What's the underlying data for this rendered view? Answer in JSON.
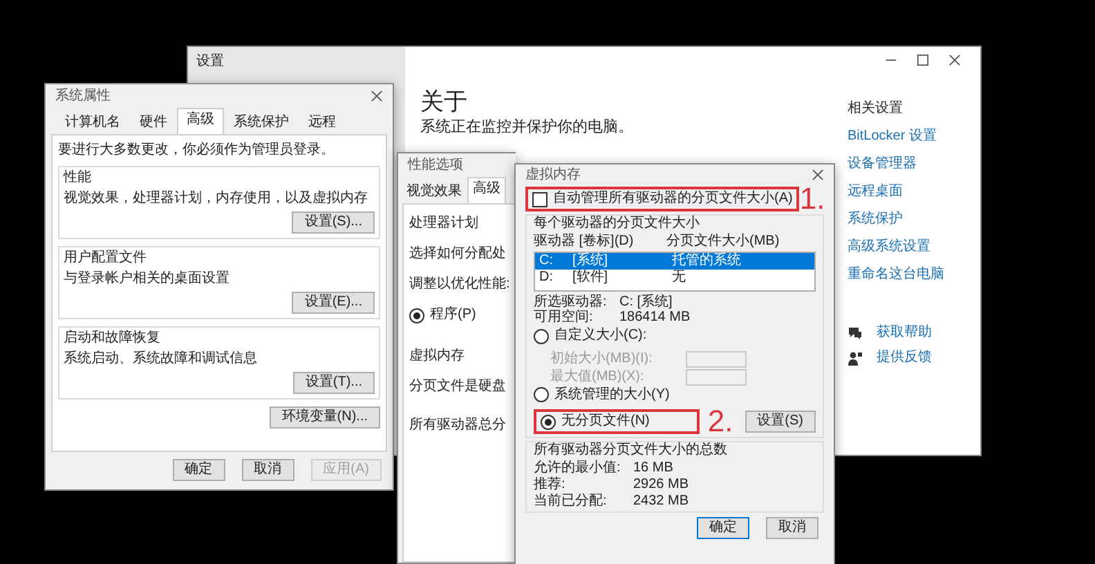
{
  "settings": {
    "title": "设置",
    "heading": "关于",
    "status": "系统正在监控并保护你的电脑。",
    "related_title": "相关设置",
    "related_links": [
      "BitLocker 设置",
      "设备管理器",
      "远程桌面",
      "系统保护",
      "高级系统设置",
      "重命名这台电脑"
    ],
    "support_links": [
      {
        "kind": "help",
        "label": "获取帮助"
      },
      {
        "kind": "feedback",
        "label": "提供反馈"
      }
    ]
  },
  "system_properties": {
    "title": "系统属性",
    "tabs": [
      {
        "label": "计算机名",
        "selected": false
      },
      {
        "label": "硬件",
        "selected": false
      },
      {
        "label": "高级",
        "selected": true
      },
      {
        "label": "系统保护",
        "selected": false
      },
      {
        "label": "远程",
        "selected": false
      }
    ],
    "note": "要进行大多数更改，你必须作为管理员登录。",
    "groups": [
      {
        "title": "性能",
        "description": "视觉效果，处理器计划，内存使用，以及虚拟内存",
        "button": "设置(S)..."
      },
      {
        "title": "用户配置文件",
        "description": "与登录帐户相关的桌面设置",
        "button": "设置(E)..."
      },
      {
        "title": "启动和故障恢复",
        "description": "系统启动、系统故障和调试信息",
        "button": "设置(T)..."
      }
    ],
    "env_button": "环境变量(N)...",
    "buttons": [
      {
        "label": "确定",
        "disabled": false
      },
      {
        "label": "取消",
        "disabled": false
      },
      {
        "label": "应用(A)",
        "disabled": true
      }
    ]
  },
  "performance_options": {
    "title": "性能选项",
    "tabs": [
      {
        "label": "视觉效果",
        "selected": false
      },
      {
        "label": "高级",
        "selected": true
      }
    ],
    "processor_title": "处理器计划",
    "processor_text": "选择如何分配处",
    "adjust_label": "调整以优化性能:",
    "radio": {
      "label": "程序(P)",
      "selected": true
    },
    "memory_title": "虚拟内存",
    "memory_text": "分页文件是硬盘",
    "memory_total": "所有驱动器总分"
  },
  "virtual_memory": {
    "title": "虚拟内存",
    "auto_manage": {
      "label": "自动管理所有驱动器的分页文件大小(A)",
      "checked": false
    },
    "annotations": [
      "1.",
      "2."
    ],
    "drive_group": "每个驱动器的分页文件大小",
    "columns": [
      "驱动器 [卷标](D)",
      "分页文件大小(MB)"
    ],
    "drives": [
      {
        "drive": "C:",
        "volume": "[系统]",
        "size": "托管的系统",
        "selected": true
      },
      {
        "drive": "D:",
        "volume": "[软件]",
        "size": "无",
        "selected": false
      }
    ],
    "drive_info": [
      {
        "label": "所选驱动器:",
        "value": "C: [系统]"
      },
      {
        "label": "可用空间:",
        "value": "186414 MB"
      }
    ],
    "radios": [
      {
        "label": "自定义大小(C):",
        "selected": false
      },
      {
        "label": "系统管理的大小(Y)",
        "selected": false
      },
      {
        "label": "无分页文件(N)",
        "selected": true
      }
    ],
    "size_fields": [
      {
        "label": "初始大小(MB)(I):",
        "disabled": true
      },
      {
        "label": "最大值(MB)(X):",
        "disabled": true
      }
    ],
    "set_button": "设置(S)",
    "totals_title": "所有驱动器分页文件大小的总数",
    "totals": [
      {
        "label": "允许的最小值:",
        "value": "16 MB"
      },
      {
        "label": "推荐:",
        "value": "2926 MB"
      },
      {
        "label": "当前已分配:",
        "value": "2432 MB"
      }
    ],
    "buttons": [
      {
        "label": "确定",
        "default": true
      },
      {
        "label": "取消",
        "default": false
      }
    ]
  }
}
